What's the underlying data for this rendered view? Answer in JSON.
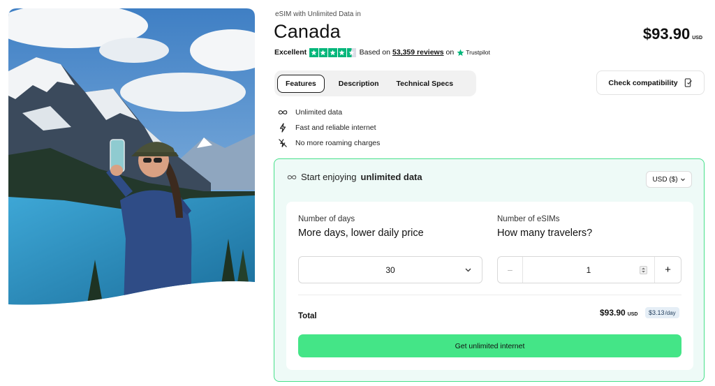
{
  "product": {
    "kicker": "eSIM with Unlimited Data in",
    "title": "Canada",
    "price": "$93.90",
    "currency": "USD"
  },
  "rating": {
    "label": "Excellent",
    "stars": 4.5,
    "based_on": "Based on",
    "reviews": "53,359 reviews",
    "on": "on",
    "provider": "Trustpilot"
  },
  "tabs": [
    "Features",
    "Description",
    "Technical Specs"
  ],
  "active_tab": "Features",
  "check_compat": "Check compatibility",
  "features": [
    {
      "icon": "infinity-icon",
      "text": "Unlimited data"
    },
    {
      "icon": "lightning-icon",
      "text": "Fast and reliable internet"
    },
    {
      "icon": "no-roaming-icon",
      "text": "No more roaming charges"
    }
  ],
  "plan": {
    "heading_prefix": "Start enjoying",
    "heading_bold": "unlimited data",
    "currency_select": "USD ($)",
    "days": {
      "label": "Number of days",
      "question": "More days, lower daily price",
      "value": "30"
    },
    "esims": {
      "label": "Number of eSIMs",
      "question": "How many travelers?",
      "value": "1",
      "minus": "−",
      "plus": "+"
    },
    "total_label": "Total",
    "total_amount": "$93.90",
    "total_currency": "USD",
    "daily_price": "$3.13",
    "daily_unit": "/day",
    "cta": "Get unlimited internet"
  },
  "colors": {
    "accent_green": "#44e587",
    "card_border": "#46e08a",
    "card_bg": "#eefaf7",
    "trustpilot_green": "#00b67a"
  }
}
